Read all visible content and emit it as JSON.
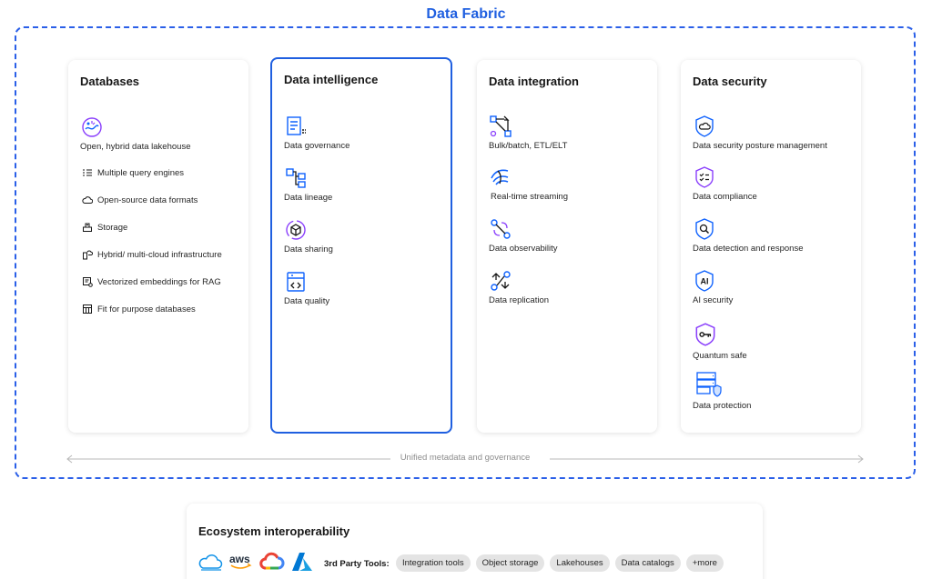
{
  "title": "Data Fabric",
  "colors": {
    "accent": "#1f5fe0",
    "icon_blue": "#0f62fe",
    "icon_purple": "#8a3ffc",
    "chip_bg": "#e4e4e4"
  },
  "databases": {
    "title": "Databases",
    "featured": {
      "label": "Open, hybrid data lakehouse",
      "icon": "lakehouse-icon"
    },
    "items": [
      {
        "label": "Multiple query engines",
        "icon": "query-engines-icon"
      },
      {
        "label": "Open-source data formats",
        "icon": "cloud-icon"
      },
      {
        "label": "Storage",
        "icon": "storage-icon"
      },
      {
        "label": "Hybrid/ multi-cloud infrastructure",
        "icon": "hybrid-cloud-icon"
      },
      {
        "label": "Vectorized embeddings for RAG",
        "icon": "embeddings-icon"
      },
      {
        "label": "Fit for purpose databases",
        "icon": "database-icon"
      }
    ]
  },
  "intelligence": {
    "title": "Data intelligence",
    "items": [
      {
        "label": "Data governance",
        "icon": "governance-icon"
      },
      {
        "label": "Data lineage",
        "icon": "lineage-icon"
      },
      {
        "label": "Data sharing",
        "icon": "sharing-icon"
      },
      {
        "label": "Data quality",
        "icon": "quality-icon"
      }
    ]
  },
  "integration": {
    "title": "Data integration",
    "items": [
      {
        "label": "Bulk/batch, ETL/ELT",
        "icon": "etl-icon"
      },
      {
        "label": "Real-time streaming",
        "icon": "streaming-icon"
      },
      {
        "label": "Data observability",
        "icon": "observability-icon"
      },
      {
        "label": "Data replication",
        "icon": "replication-icon"
      }
    ]
  },
  "security": {
    "title": "Data security",
    "items": [
      {
        "label": "Data security posture management",
        "icon": "shield-cloud-icon"
      },
      {
        "label": "Data compliance",
        "icon": "shield-checklist-icon"
      },
      {
        "label": "Data detection and response",
        "icon": "shield-search-icon"
      },
      {
        "label": "AI security",
        "icon": "shield-ai-icon"
      },
      {
        "label": "Quantum safe",
        "icon": "shield-key-icon"
      },
      {
        "label": "Data protection",
        "icon": "server-shield-icon"
      }
    ]
  },
  "unified": "Unified metadata and governance",
  "ecosystem": {
    "title": "Ecosystem interoperability",
    "logos": [
      "ibm-cloud-logo",
      "aws-logo",
      "google-cloud-logo",
      "azure-logo"
    ],
    "aws_text": "aws",
    "azure_text": "A",
    "tools_label": "3rd Party Tools:",
    "chips": [
      "Integration tools",
      "Object storage",
      "Lakehouses",
      "Data catalogs",
      "+more"
    ]
  }
}
